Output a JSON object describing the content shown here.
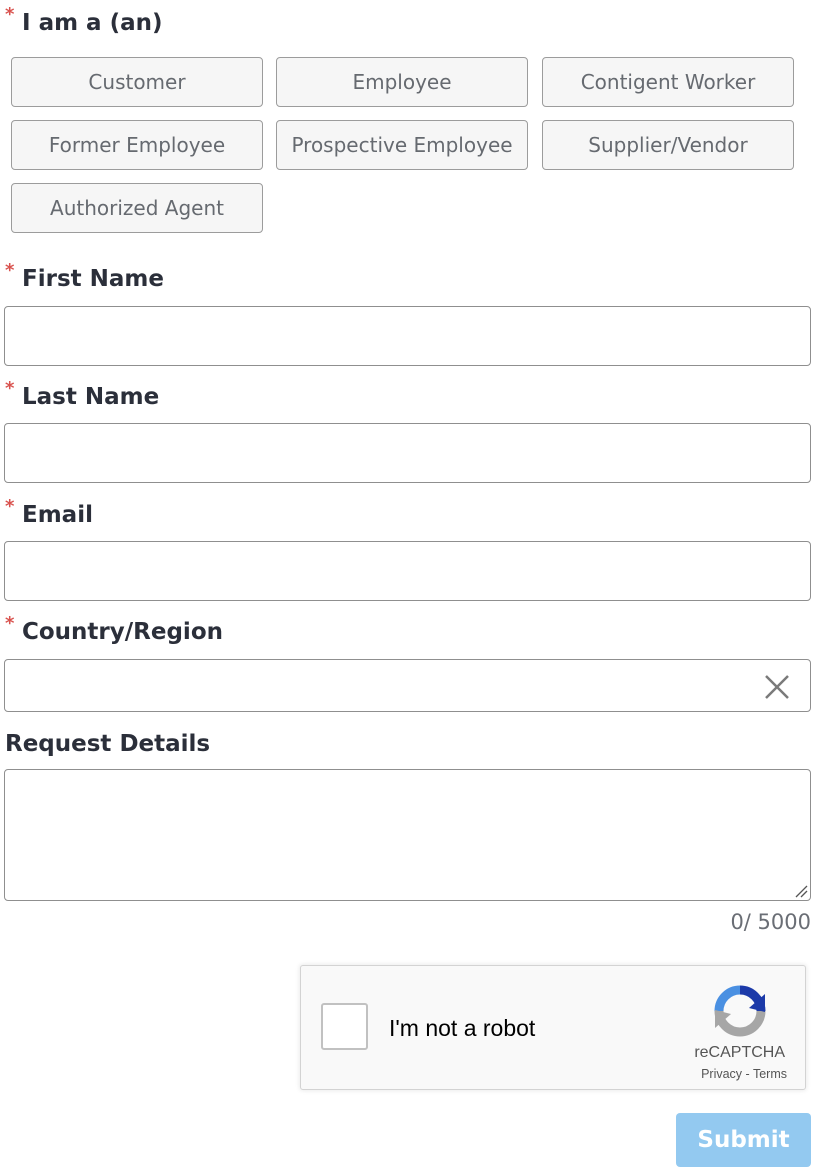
{
  "form": {
    "required_marker": "*",
    "role": {
      "label": "I am a (an)",
      "options": [
        "Customer",
        "Employee",
        "Contigent Worker",
        "Former Employee",
        "Prospective Employee",
        "Supplier/Vendor",
        "Authorized Agent"
      ]
    },
    "first_name": {
      "label": "First Name",
      "value": ""
    },
    "last_name": {
      "label": "Last Name",
      "value": ""
    },
    "email": {
      "label": "Email",
      "value": ""
    },
    "country": {
      "label": "Country/Region",
      "value": "",
      "clear_icon": "close-icon"
    },
    "request_details": {
      "label": "Request Details",
      "value": "",
      "counter": "0/ 5000"
    },
    "captcha": {
      "checkbox_label": "I'm not a robot",
      "brand": "reCAPTCHA",
      "privacy": "Privacy",
      "separator": "-",
      "terms": "Terms",
      "checked": false
    },
    "submit_label": "Submit"
  },
  "colors": {
    "required": "#d9534f",
    "label": "#2b2f3a",
    "submit_bg": "#93c9f0",
    "option_bg": "#f6f6f6"
  }
}
